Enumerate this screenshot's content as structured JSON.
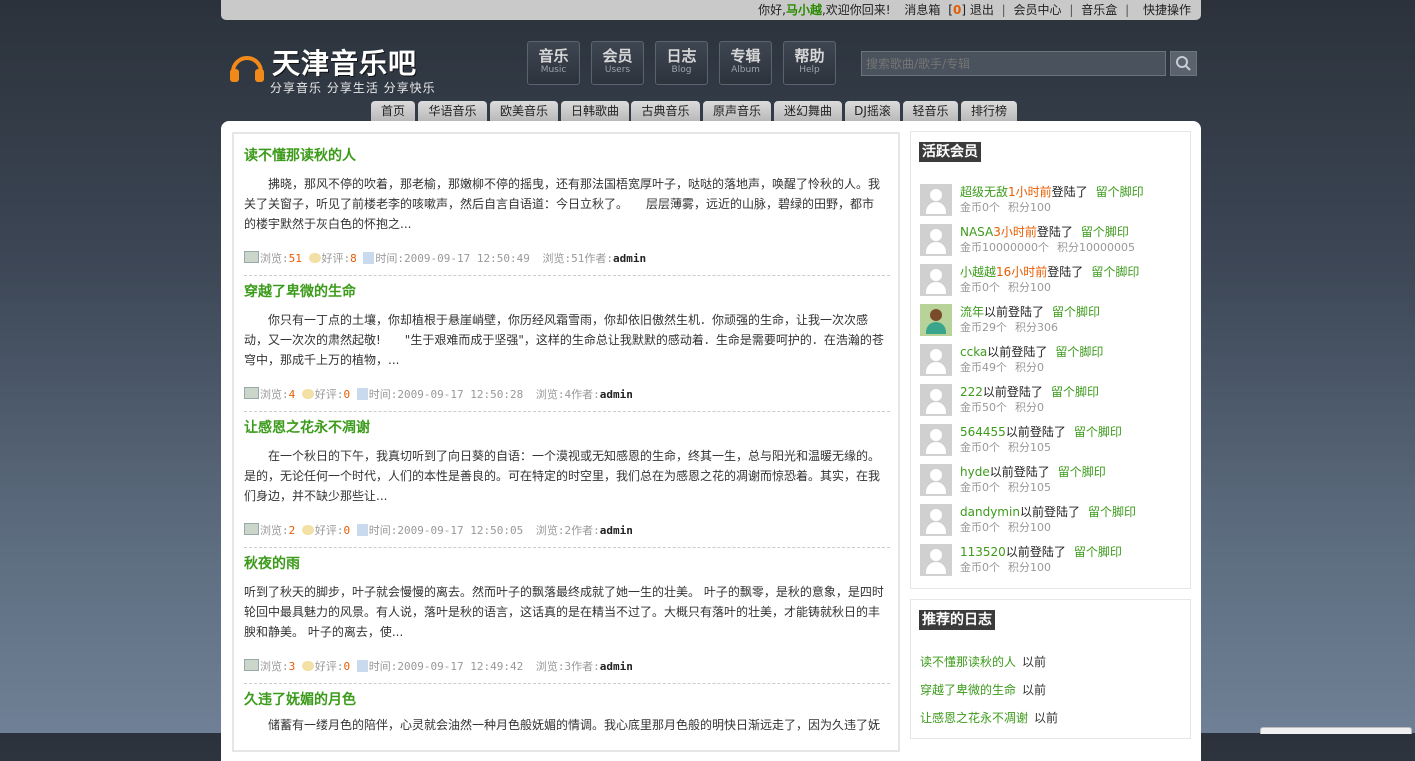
{
  "topbar": {
    "greeting": "你好,",
    "username": "马小越",
    "welcome": ",欢迎你回来!",
    "inbox": "消息箱",
    "inbox_open": "[",
    "inbox_count": "0",
    "inbox_close": "]",
    "logout": "退出",
    "member_center": "会员中心",
    "music_box": "音乐盒",
    "quick_ops": "快捷操作"
  },
  "logo": {
    "title": "天津音乐吧",
    "subtitle": "分享音乐  分享生活  分享快乐"
  },
  "iconnav": [
    {
      "cn": "音乐",
      "en": "Music"
    },
    {
      "cn": "会员",
      "en": "Users"
    },
    {
      "cn": "日志",
      "en": "Blog"
    },
    {
      "cn": "专辑",
      "en": "Album"
    },
    {
      "cn": "帮助",
      "en": "Help"
    }
  ],
  "search": {
    "placeholder": "搜索歌曲/歌手/专辑"
  },
  "tabs": [
    "首页",
    "华语音乐",
    "欧美音乐",
    "日韩歌曲",
    "古典音乐",
    "原声音乐",
    "迷幻舞曲",
    "DJ摇滚",
    "轻音乐",
    "排行榜"
  ],
  "posts": [
    {
      "title": "读不懂那读秋的人",
      "excerpt": "　　拂晓，那风不停的吹着，那老榆，那嫩柳不停的摇曳，还有那法国梧宽厚叶子，哒哒的落地声，唤醒了怜秋的人。我关了关窗子，听见了前楼老李的咳嗽声，然后自言自语道：今日立秋了。　　层层薄雾，远近的山脉，碧绿的田野，都市的楼宇默然于灰白色的怀抱之...",
      "views_label": "浏览:",
      "views": "51",
      "likes_label": "好评:",
      "likes": "8",
      "time": "时间:2009-09-17 12:50:49",
      "views2": "浏览:51",
      "author_label": "作者:",
      "author": "admin"
    },
    {
      "title": "穿越了卑微的生命",
      "excerpt": "　　你只有一丁点的土壤，你却植根于悬崖峭壁，你历经风霜雪雨，你却依旧傲然生机．你顽强的生命，让我一次次感动，又一次次的肃然起敬!　　\"生于艰难而成于坚强\"，这样的生命总让我默默的感动着．生命是需要呵护的．在浩瀚的苍穹中，那成千上万的植物，...",
      "views_label": "浏览:",
      "views": "4",
      "likes_label": "好评:",
      "likes": "0",
      "time": "时间:2009-09-17 12:50:28",
      "views2": "浏览:4",
      "author_label": "作者:",
      "author": "admin"
    },
    {
      "title": "让感恩之花永不凋谢",
      "excerpt": "　　在一个秋日的下午，我真切听到了向日葵的自语：一个漠视或无知感恩的生命，终其一生，总与阳光和温暖无缘的。　　是的，无论任何一个时代，人们的本性是善良的。可在特定的时空里，我们总在为感恩之花的凋谢而惊恐着。其实，在我们身边，并不缺少那些让...",
      "views_label": "浏览:",
      "views": "2",
      "likes_label": "好评:",
      "likes": "0",
      "time": "时间:2009-09-17 12:50:05",
      "views2": "浏览:2",
      "author_label": "作者:",
      "author": "admin"
    },
    {
      "title": "秋夜的雨",
      "excerpt": "听到了秋天的脚步，叶子就会慢慢的离去。然而叶子的飘落最终成就了她一生的壮美。 叶子的飘零，是秋的意象，是四时轮回中最具魅力的风景。有人说，落叶是秋的语言，这话真的是在精当不过了。大概只有落叶的壮美，才能铸就秋日的丰腴和静美。 叶子的离去，使...",
      "views_label": "浏览:",
      "views": "3",
      "likes_label": "好评:",
      "likes": "0",
      "time": "时间:2009-09-17 12:49:42",
      "views2": "浏览:3",
      "author_label": "作者:",
      "author": "admin"
    },
    {
      "title": "久违了妩媚的月色",
      "excerpt": "　　储蓄有一缕月色的陪伴，心灵就会油然一种月色般妩媚的情调。我心底里那月色般的明快日渐远走了，因为久违了妩",
      "views_label": "",
      "views": "",
      "likes_label": "",
      "likes": "",
      "time": "",
      "views2": "",
      "author_label": "",
      "author": ""
    }
  ],
  "active_members": {
    "title": "活跃会员",
    "logged_in": "登陆了",
    "footprint": "留个脚印",
    "items": [
      {
        "name": "超级无敌",
        "when": "1小时前",
        "gold": "金币0个",
        "points": "积分100",
        "photo": false
      },
      {
        "name": "NASA",
        "when": "3小时前",
        "gold": "金币10000000个",
        "points": "积分10000005",
        "photo": false
      },
      {
        "name": "小越越",
        "when": "16小时前",
        "gold": "金币0个",
        "points": "积分100",
        "photo": false
      },
      {
        "name": "流年",
        "when": "以前",
        "gold": "金币29个",
        "points": "积分306",
        "photo": true
      },
      {
        "name": "ccka",
        "when": "以前",
        "gold": "金币49个",
        "points": "积分0",
        "photo": false
      },
      {
        "name": "222",
        "when": "以前",
        "gold": "金币50个",
        "points": "积分0",
        "photo": false
      },
      {
        "name": "564455",
        "when": "以前",
        "gold": "金币0个",
        "points": "积分105",
        "photo": false
      },
      {
        "name": "hyde",
        "when": "以前",
        "gold": "金币0个",
        "points": "积分105",
        "photo": false
      },
      {
        "name": "dandymin",
        "when": "以前",
        "gold": "金币0个",
        "points": "积分100",
        "photo": false
      },
      {
        "name": "113520",
        "when": "以前",
        "gold": "金币0个",
        "points": "积分100",
        "photo": false
      }
    ]
  },
  "recommended": {
    "title": "推荐的日志",
    "items": [
      {
        "title": "读不懂那读秋的人",
        "when": "以前"
      },
      {
        "title": "穿越了卑微的生命",
        "when": "以前"
      },
      {
        "title": "让感恩之花永不凋谢",
        "when": "以前"
      }
    ]
  }
}
